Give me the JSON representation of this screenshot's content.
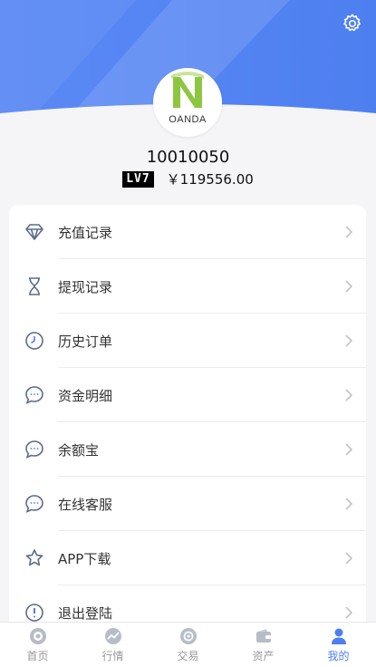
{
  "profile": {
    "avatar_text": "OANDA",
    "user_id": "10010050",
    "level": "LV7",
    "balance": "￥119556.00"
  },
  "menu": [
    {
      "label": "充值记录",
      "icon": "diamond-icon"
    },
    {
      "label": "提现记录",
      "icon": "hourglass-icon"
    },
    {
      "label": "历史订单",
      "icon": "clock-icon"
    },
    {
      "label": "资金明细",
      "icon": "chat-bubble-icon"
    },
    {
      "label": "余额宝",
      "icon": "chat-bubble-icon"
    },
    {
      "label": "在线客服",
      "icon": "chat-bubble-icon"
    },
    {
      "label": "APP下载",
      "icon": "star-icon"
    },
    {
      "label": "退出登陆",
      "icon": "exclamation-icon"
    }
  ],
  "tabs": [
    {
      "label": "首页",
      "icon": "home-icon"
    },
    {
      "label": "行情",
      "icon": "trend-icon"
    },
    {
      "label": "交易",
      "icon": "exchange-icon"
    },
    {
      "label": "资产",
      "icon": "wallet-icon"
    },
    {
      "label": "我的",
      "icon": "user-icon",
      "active": true
    }
  ],
  "colors": {
    "accent": "#4f7ef2",
    "header_blue": "#5b8af5",
    "tab_inactive": "#999999"
  }
}
